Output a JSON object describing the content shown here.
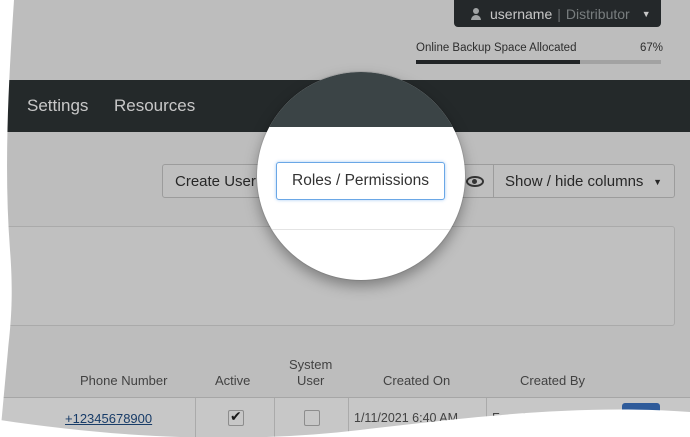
{
  "user_menu": {
    "username": "username",
    "separator": "|",
    "role": "Distributor",
    "icon": "user-icon",
    "caret_icon": "caret-down-icon"
  },
  "backup": {
    "label": "Online Backup Space Allocated",
    "percent_label": "67%",
    "percent": 67
  },
  "nav": {
    "items": [
      {
        "label": "Settings"
      },
      {
        "label": "Resources"
      }
    ]
  },
  "toolbar": {
    "create_user": "Create User",
    "roles_permissions": "Roles / Permissions",
    "eye_icon": "eye-icon",
    "show_hide_columns": "Show / hide columns"
  },
  "table": {
    "headers": {
      "phone": "Phone Number",
      "active": "Active",
      "system_user_1": "System",
      "system_user_2": "User",
      "created_on": "Created On",
      "created_by": "Created By"
    },
    "rows": [
      {
        "phone": "+12345678900",
        "active": true,
        "system_user": false,
        "created_on": "1/11/2021 6:40 AM",
        "created_by": "Free St",
        "action_icon": "gear-icon"
      }
    ]
  },
  "colors": {
    "navbar": "#2f3537",
    "accent": "#3d75c6",
    "highlight_border": "#6aa7e6"
  }
}
